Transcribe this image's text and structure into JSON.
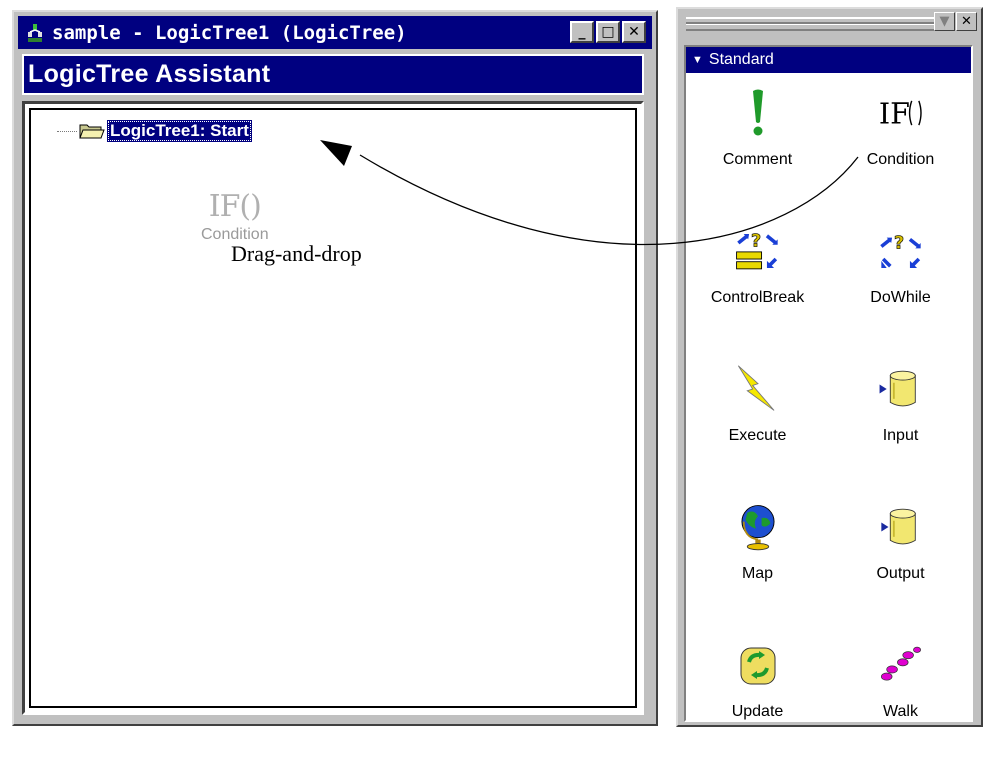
{
  "window": {
    "title": "sample - LogicTree1 (LogicTree)",
    "minimize_glyph": "_",
    "maximize_glyph": "□",
    "close_glyph": "✕"
  },
  "assistant": {
    "header": "LogicTree Assistant"
  },
  "tree": {
    "root_label": "LogicTree1: Start",
    "drag_ghost": {
      "glyph": "IF()",
      "label": "Condition"
    }
  },
  "palette": {
    "collapse_glyph": "▼",
    "close_glyph": "✕",
    "section_title": "Standard",
    "section_toggle": "▼",
    "tools": [
      {
        "label": "Comment",
        "icon": "exclamation-icon"
      },
      {
        "label": "Condition",
        "icon": "if-condition-icon"
      },
      {
        "label": "ControlBreak",
        "icon": "control-break-icon"
      },
      {
        "label": "DoWhile",
        "icon": "do-while-icon"
      },
      {
        "label": "Execute",
        "icon": "lightning-icon"
      },
      {
        "label": "Input",
        "icon": "input-cylinder-icon"
      },
      {
        "label": "Map",
        "icon": "globe-icon"
      },
      {
        "label": "Output",
        "icon": "output-cylinder-icon"
      },
      {
        "label": "Update",
        "icon": "update-recycle-icon"
      },
      {
        "label": "Walk",
        "icon": "footprints-icon"
      }
    ]
  },
  "annotation": {
    "caption": "Drag-and-drop"
  },
  "colors": {
    "titlebar": "#000080",
    "chrome": "#c0c0c0",
    "selection": "#000080"
  }
}
